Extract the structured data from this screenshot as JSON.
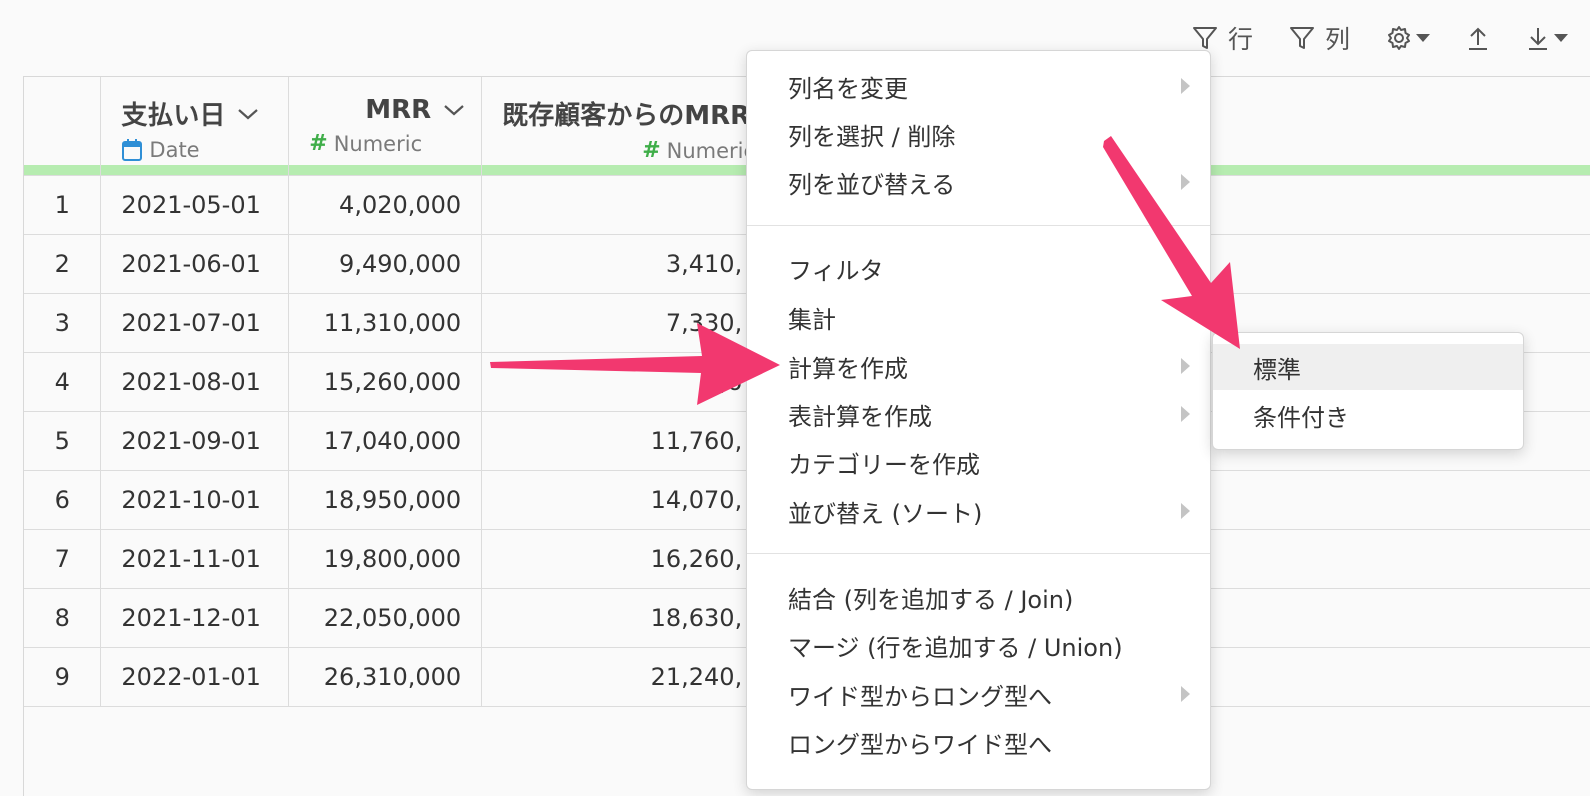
{
  "toolbar": {
    "row_filter_label": "行",
    "column_filter_label": "列"
  },
  "table": {
    "columns": [
      {
        "name": "支払い日",
        "type": "Date"
      },
      {
        "name": "MRR",
        "type": "Numeric"
      },
      {
        "name": "既存顧客からのMRR",
        "type": "Numeric"
      }
    ],
    "rows": [
      {
        "index": "1",
        "date": "2021-05-01",
        "mrr": "4,020,000",
        "existing": ""
      },
      {
        "index": "2",
        "date": "2021-06-01",
        "mrr": "9,490,000",
        "existing": "3,410,"
      },
      {
        "index": "3",
        "date": "2021-07-01",
        "mrr": "11,310,000",
        "existing": "7,330,"
      },
      {
        "index": "4",
        "date": "2021-08-01",
        "mrr": "15,260,000",
        "existing": "9,6"
      },
      {
        "index": "5",
        "date": "2021-09-01",
        "mrr": "17,040,000",
        "existing": "11,760,"
      },
      {
        "index": "6",
        "date": "2021-10-01",
        "mrr": "18,950,000",
        "existing": "14,070,"
      },
      {
        "index": "7",
        "date": "2021-11-01",
        "mrr": "19,800,000",
        "existing": "16,260,"
      },
      {
        "index": "8",
        "date": "2021-12-01",
        "mrr": "22,050,000",
        "existing": "18,630,"
      },
      {
        "index": "9",
        "date": "2022-01-01",
        "mrr": "26,310,000",
        "existing": "21,240,"
      }
    ]
  },
  "menu": {
    "items": [
      "列名を変更",
      "列を選択 / 削除",
      "列を並び替える",
      "フィルタ",
      "集計",
      "計算を作成",
      "表計算を作成",
      "カテゴリーを作成",
      "並び替え (ソート)",
      "結合 (列を追加する / Join)",
      "マージ (行を追加する / Union)",
      "ワイド型からロング型へ",
      "ロング型からワイド型へ"
    ]
  },
  "submenu": {
    "items": [
      "標準",
      "条件付き"
    ]
  },
  "colors": {
    "accent_green": "#b6ecb0",
    "arrow_pink": "#f2386f",
    "date_icon_blue": "#2f8fd6",
    "numeric_hash_green": "#3fae49"
  }
}
